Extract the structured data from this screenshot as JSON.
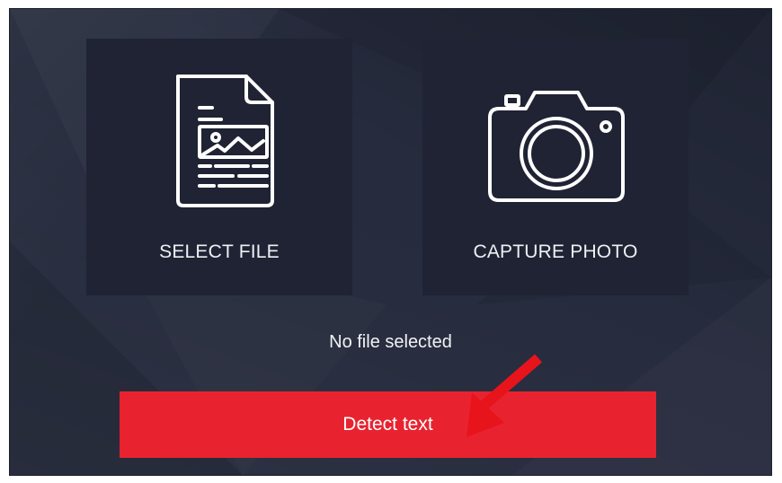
{
  "tiles": {
    "select_file": {
      "label": "SELECT FILE",
      "icon": "document-image-icon"
    },
    "capture_photo": {
      "label": "CAPTURE PHOTO",
      "icon": "camera-icon"
    }
  },
  "status": {
    "text": "No file selected"
  },
  "actions": {
    "detect_label": "Detect text"
  },
  "colors": {
    "background": "#262b3d",
    "tile": "#1f2334",
    "accent_button": "#e8232f",
    "annotation_arrow": "#e8141b",
    "icon_stroke": "#ffffff"
  },
  "annotation": {
    "icon": "red-pointer-arrow",
    "target": "detect-text-button"
  }
}
